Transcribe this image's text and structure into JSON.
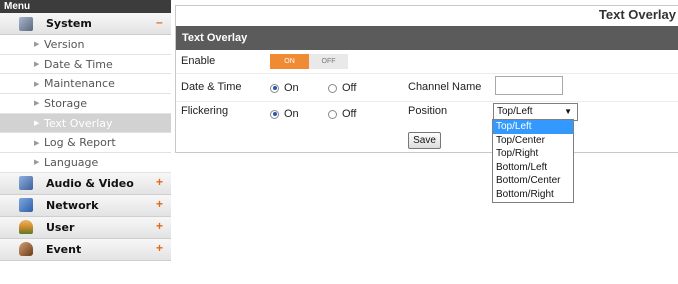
{
  "sidebar": {
    "header": "Menu",
    "sections": [
      {
        "label": "System",
        "toggle": "–",
        "icon": "system-icon",
        "color": "#6a7fa0"
      },
      {
        "label": "Audio & Video",
        "toggle": "+",
        "icon": "camera-icon",
        "color": "#5c7fb8"
      },
      {
        "label": "Network",
        "toggle": "+",
        "icon": "network-icon",
        "color": "#4a78b8"
      },
      {
        "label": "User",
        "toggle": "+",
        "icon": "user-icon",
        "color": "#c08a3a"
      },
      {
        "label": "Event",
        "toggle": "+",
        "icon": "event-icon",
        "color": "#8a5a3a"
      }
    ],
    "system_items": [
      "Version",
      "Date & Time",
      "Maintenance",
      "Storage",
      "Text Overlay",
      "Log & Report",
      "Language"
    ],
    "active_item": "Text Overlay",
    "toggle_color": "#e36a14"
  },
  "page": {
    "title": "Text Overlay",
    "section": "Text Overlay"
  },
  "form": {
    "enable": {
      "label": "Enable",
      "on": "ON",
      "off": "OFF",
      "state": "ON"
    },
    "date_time": {
      "label": "Date & Time",
      "on": "On",
      "off": "Off",
      "selected": "On"
    },
    "channel_name": {
      "label": "Channel Name",
      "value": ""
    },
    "flickering": {
      "label": "Flickering",
      "on": "On",
      "off": "Off",
      "selected": "On"
    },
    "position": {
      "label": "Position",
      "selected": "Top/Left",
      "options": [
        "Top/Left",
        "Top/Center",
        "Top/Right",
        "Bottom/Left",
        "Bottom/Center",
        "Bottom/Right"
      ]
    },
    "save_label": "Save"
  },
  "colors": {
    "accent": "#f08a33",
    "section_bar": "#5b5b5b",
    "highlight": "#3399ff"
  }
}
